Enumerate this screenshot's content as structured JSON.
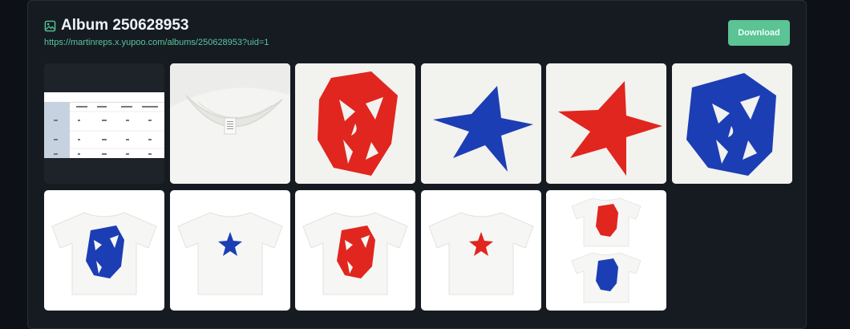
{
  "album": {
    "title": "Album 250628953",
    "url": "https://martinreps.x.yupoo.com/albums/250628953?uid=1",
    "download_label": "Download",
    "icon": "image-icon"
  },
  "colors": {
    "accent": "#5bc394",
    "link": "#57c79a",
    "background": "#0d1117",
    "card": "#161b22",
    "print_red": "#e0261f",
    "print_blue": "#1c3eb4"
  },
  "photos": [
    {
      "name": "size-chart"
    },
    {
      "name": "collar-closeup"
    },
    {
      "name": "red-mask-print"
    },
    {
      "name": "blue-star-print"
    },
    {
      "name": "red-star-print"
    },
    {
      "name": "blue-mask-print"
    },
    {
      "name": "white-tee-blue-mask"
    },
    {
      "name": "white-tee-blue-star"
    },
    {
      "name": "white-tee-red-mask"
    },
    {
      "name": "white-tee-red-star"
    },
    {
      "name": "two-tees-red-blue-mask"
    }
  ]
}
